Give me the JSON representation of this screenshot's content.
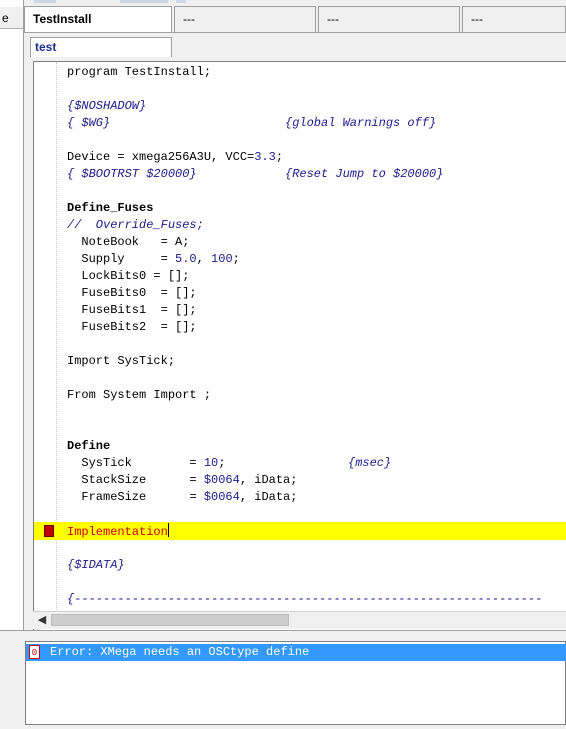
{
  "top_partial_label": "e",
  "tabs": [
    {
      "label": "TestInstall",
      "active": true
    },
    {
      "label": "---"
    },
    {
      "label": "---"
    },
    {
      "label": "---"
    }
  ],
  "subtab": {
    "label": "test"
  },
  "code_lines": {
    "l1": "program TestInstall;",
    "l2": "{$NOSHADOW}",
    "l3a": "{ $WG}",
    "l3b": "{global Warnings off}",
    "l4a": "Device = xmega256A3U, VCC=",
    "l4b": "3.3",
    "l4c": ";",
    "l5a": "{ $BOOTRST $20000}",
    "l5b": "{Reset Jump to $20000}",
    "l6": "Define_Fuses",
    "l7": "//  Override_Fuses;",
    "l8": "  NoteBook   = A;",
    "l9a": "  Supply     = ",
    "l9b": "5.0",
    "l9c": ", ",
    "l9d": "100",
    "l9e": ";",
    "l10": "  LockBits0 = [];",
    "l11": "  FuseBits0  = [];",
    "l12": "  FuseBits1  = [];",
    "l13": "  FuseBits2  = [];",
    "l14": "Import SysTick;",
    "l15": "From System Import ;",
    "l16": "Define",
    "l17a": "  SysTick        = ",
    "l17b": "10",
    "l17c": ";",
    "l17d": "{msec}",
    "l18a": "  StackSize      = ",
    "l18b": "$0064",
    "l18c": ", iData;",
    "l19a": "  FrameSize      = ",
    "l19b": "$0064",
    "l19c": ", iData;",
    "l20": "Implementation",
    "l21": "{$IDATA}",
    "l22": "{-----------------------------------------------------------------"
  },
  "messages": [
    {
      "icon": "0",
      "text": "Error: XMega needs an OSCtype define"
    }
  ],
  "colors": {
    "highlight": "#ffff00",
    "comment": "#1a1a8c",
    "implementation": "#cc0000",
    "selection": "#3399ff"
  }
}
